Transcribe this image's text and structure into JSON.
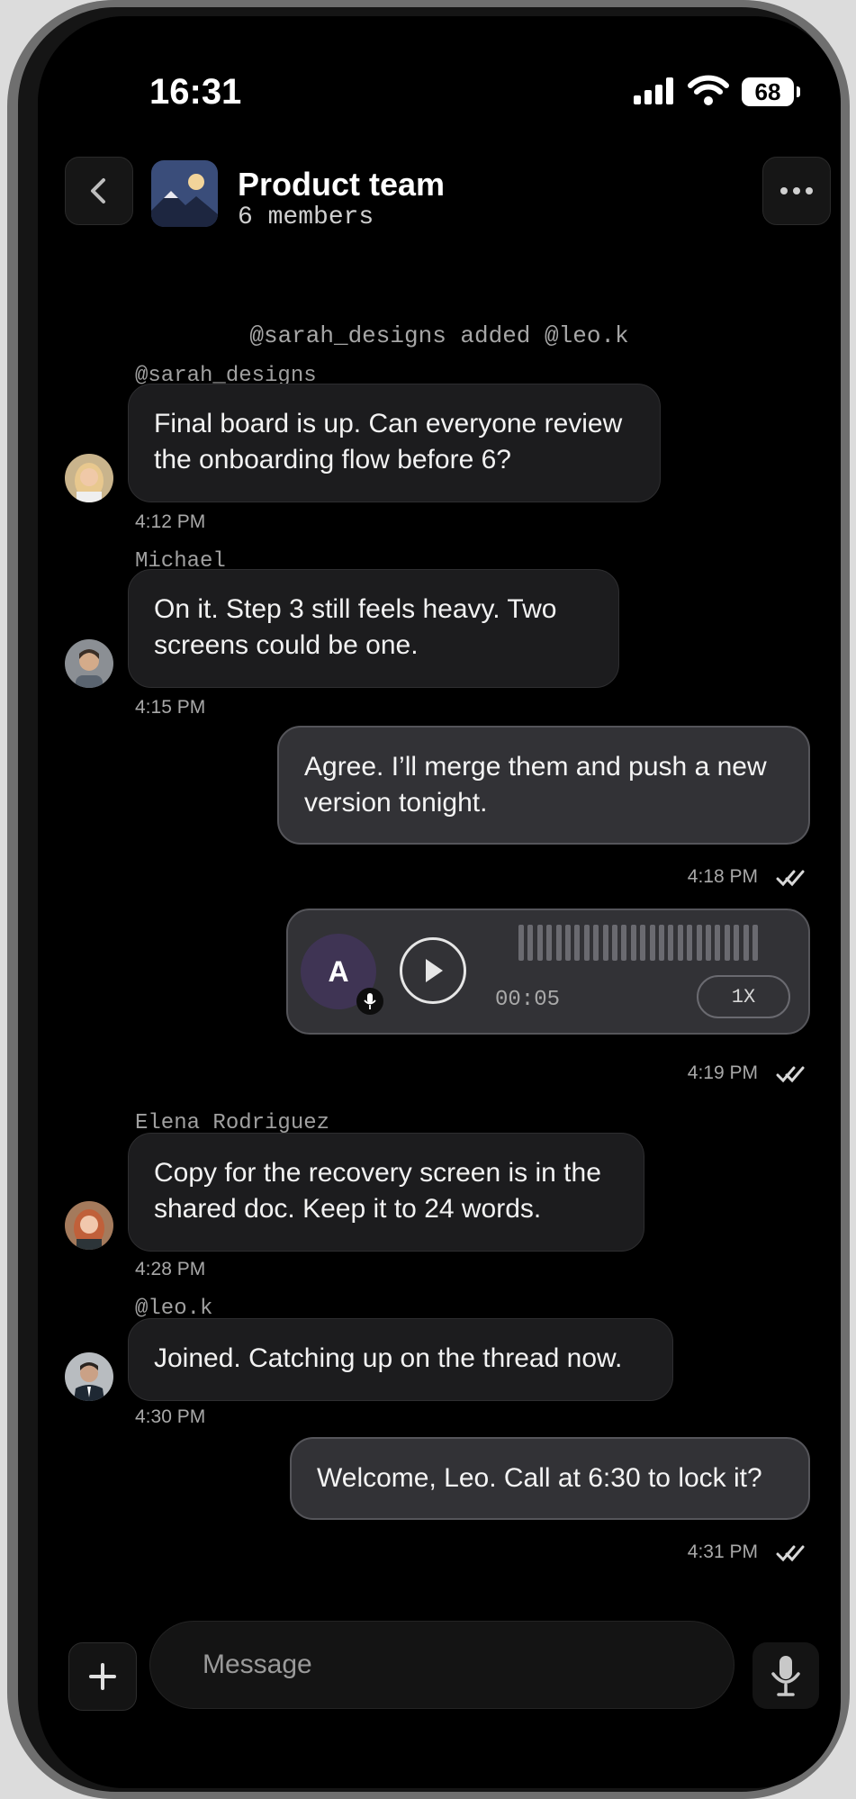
{
  "status_bar": {
    "time": "16:31",
    "battery": "68"
  },
  "header": {
    "title": "Product team",
    "subtitle": "6 members"
  },
  "system_note": "@sarah_designs added @leo.k",
  "messages": [
    {
      "sender": "@sarah_designs",
      "text": "Final board is up. Can everyone review the onboarding flow before 6?",
      "time": "4:12 PM"
    },
    {
      "sender": "Michael",
      "text": "On it. Step 3 still feels heavy. Two screens could be one.",
      "time": "4:15 PM"
    },
    {
      "text": "Agree. I’ll merge them and push a new version tonight.",
      "time": "4:18 PM"
    },
    {
      "voice": {
        "avatar_letter": "A",
        "duration": "00:05",
        "speed": "1X"
      },
      "time": "4:19 PM"
    },
    {
      "sender": "Elena Rodriguez",
      "text": "Copy for the recovery screen is in the shared doc. Keep it to 24 words.",
      "time": "4:28 PM"
    },
    {
      "sender": "@leo.k",
      "text": "Joined. Catching up on the thread now.",
      "time": "4:30 PM"
    },
    {
      "text": "Welcome, Leo. Call at 6:30 to lock it?",
      "time": "4:31 PM"
    }
  ],
  "composer": {
    "placeholder": "Message"
  },
  "icons": {
    "back": "chevron-left-icon",
    "more": "more-horizontal-icon",
    "plus": "plus-icon",
    "mic": "microphone-icon",
    "play": "play-icon",
    "read": "double-check-icon"
  },
  "colors": {
    "background": "#000000",
    "bubble_incoming": "#1c1c1e",
    "bubble_outgoing": "#323236",
    "voice_avatar": "#3f3454"
  }
}
